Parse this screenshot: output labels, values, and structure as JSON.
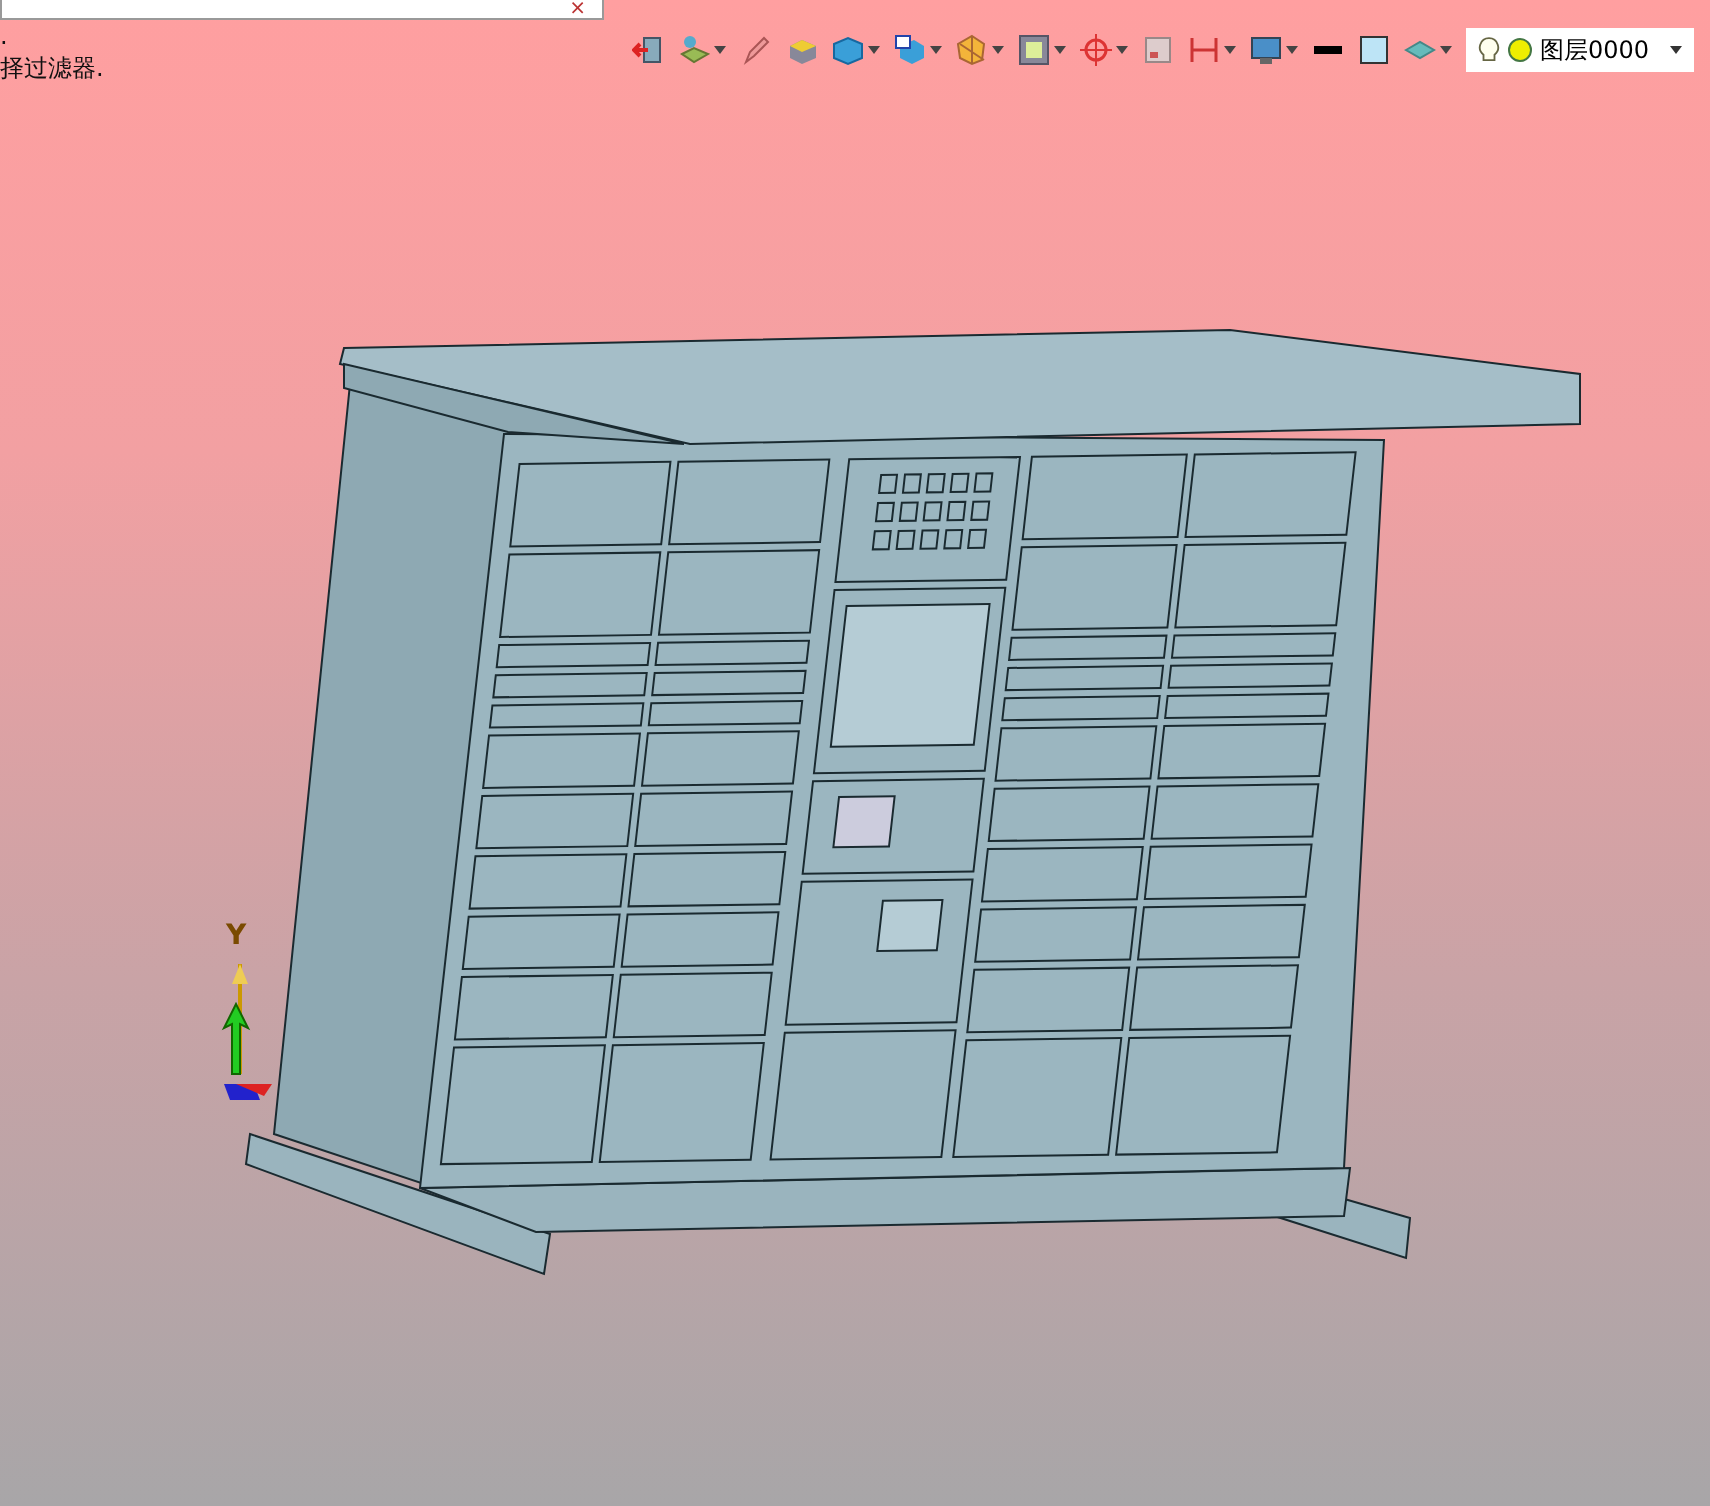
{
  "tab": {
    "close": "×"
  },
  "prompt": {
    "lines": [
      ".",
      "择过滤器."
    ]
  },
  "toolbar": {
    "items": [
      {
        "kind": "exit",
        "dropdown": false
      },
      {
        "kind": "layers",
        "dropdown": true
      },
      {
        "kind": "pencil",
        "dropdown": false
      },
      {
        "kind": "block",
        "dropdown": false
      },
      {
        "kind": "cube",
        "dropdown": true
      },
      {
        "kind": "view",
        "dropdown": true
      },
      {
        "kind": "polygon",
        "dropdown": true
      },
      {
        "kind": "frame",
        "dropdown": true
      },
      {
        "kind": "crosshair",
        "dropdown": true
      },
      {
        "kind": "window",
        "dropdown": false
      },
      {
        "kind": "dimension",
        "dropdown": true
      },
      {
        "kind": "monitor",
        "dropdown": true
      },
      {
        "kind": "line",
        "dropdown": false
      },
      {
        "kind": "swatch",
        "dropdown": false
      },
      {
        "kind": "stack",
        "dropdown": true
      }
    ],
    "layer": {
      "value": "图层0000"
    }
  },
  "axis": {
    "label": "Y"
  }
}
